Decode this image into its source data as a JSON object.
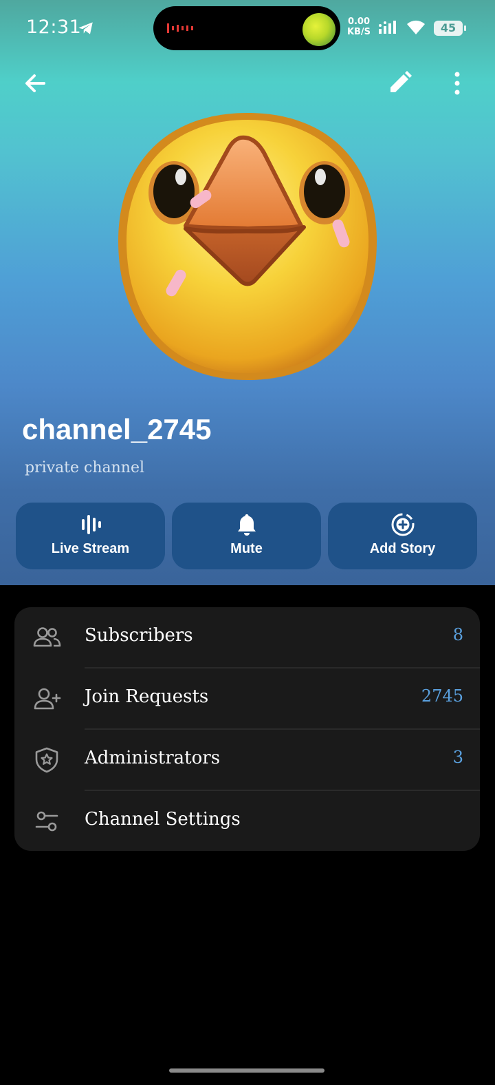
{
  "status_bar": {
    "time": "12:31",
    "net_speed_value": "0.00",
    "net_speed_unit": "KB/S",
    "battery": "45"
  },
  "profile": {
    "name": "channel_2745",
    "subtitle": "private channel"
  },
  "actions": [
    {
      "label": "Live Stream",
      "icon": "live-stream-icon"
    },
    {
      "label": "Mute",
      "icon": "bell-icon"
    },
    {
      "label": "Add Story",
      "icon": "add-story-icon"
    }
  ],
  "menu": [
    {
      "label": "Subscribers",
      "value": "8",
      "icon": "people-icon"
    },
    {
      "label": "Join Requests",
      "value": "2745",
      "icon": "person-add-icon"
    },
    {
      "label": "Administrators",
      "value": "3",
      "icon": "shield-star-icon"
    },
    {
      "label": "Channel Settings",
      "value": "",
      "icon": "sliders-icon"
    }
  ],
  "colors": {
    "action_button": "#1f5289",
    "menu_background": "#1a1a1a",
    "value_accent": "#5aa0de"
  }
}
